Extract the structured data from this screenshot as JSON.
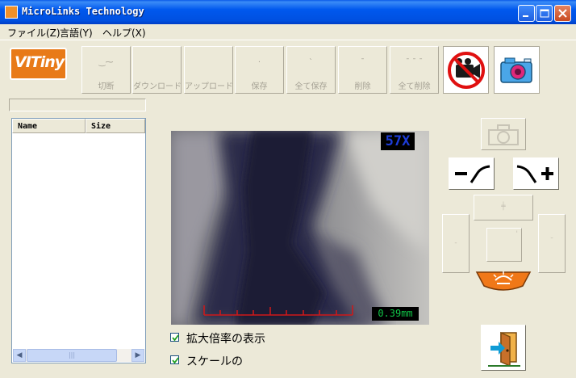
{
  "window": {
    "title": "MicroLinks Technology"
  },
  "menu": {
    "items": [
      "ファイル(Z)",
      "言語(Y)",
      "ヘルプ(X)"
    ]
  },
  "logo": {
    "text": "VITiny"
  },
  "toolbar": {
    "buttons": [
      {
        "label": "切断",
        "glyph": "‿⁓"
      },
      {
        "label": "ダウンロード",
        "glyph": ""
      },
      {
        "label": "アップロード",
        "glyph": ""
      },
      {
        "label": "保存",
        "glyph": "·"
      },
      {
        "label": "全て保存",
        "glyph": "`"
      },
      {
        "label": "削除",
        "glyph": "ˉ"
      },
      {
        "label": "全て削除",
        "glyph": "ˉ ˉ ˉ"
      }
    ],
    "icons": [
      "video-off-icon",
      "camera-icon"
    ]
  },
  "filelist": {
    "columns": [
      "Name",
      "Size"
    ]
  },
  "scrollbar": {
    "thumb_grip": "|||"
  },
  "viewer": {
    "magnification": "57X",
    "scale": "0.39mm"
  },
  "options": {
    "show_magnification": {
      "label": "拡大倍率の表示",
      "checked": true
    },
    "show_scale": {
      "label": "スケールの",
      "checked": true
    }
  },
  "colors": {
    "titlebar": "#0058ee",
    "logo": "#e87a18",
    "magnification_text": "#1d3cd8",
    "scale_text": "#11c247",
    "scale_ruler": "#d01818"
  }
}
